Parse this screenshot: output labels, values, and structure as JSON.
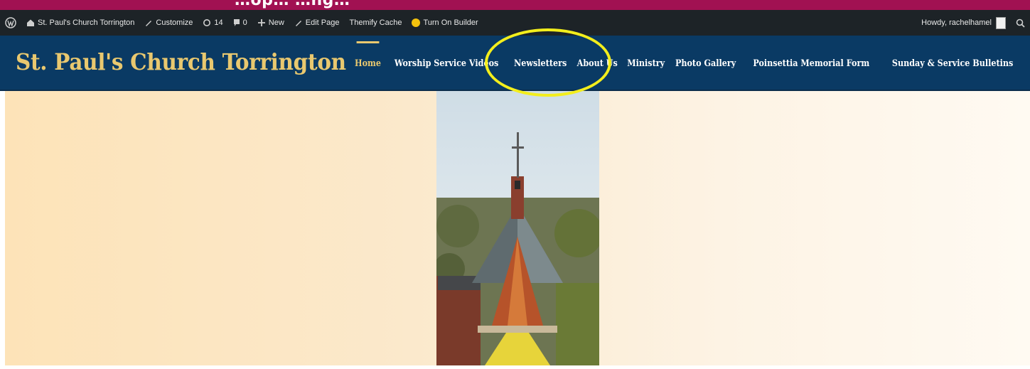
{
  "top_strip": {
    "partial_heading": "…op… …ng…"
  },
  "adminbar": {
    "site_name": "St. Paul's Church Torrington",
    "customize": "Customize",
    "updates_count": "14",
    "comments_count": "0",
    "new": "New",
    "edit_page": "Edit Page",
    "themify_cache": "Themify Cache",
    "turn_on_builder": "Turn On Builder",
    "howdy": "Howdy, rachelhamel"
  },
  "header": {
    "site_title": "St. Paul's Church Torrington",
    "nav": [
      {
        "label": "Home",
        "active": true
      },
      {
        "label": "Worship Service Videos"
      },
      {
        "label": "Newsletters"
      },
      {
        "label": "About Us"
      },
      {
        "label": "Ministry"
      },
      {
        "label": "Photo Gallery"
      },
      {
        "label": "Poinsettia Memorial Form"
      },
      {
        "label": "Sunday & Service Bulletins"
      }
    ]
  },
  "colors": {
    "brand_navy": "#0a3a64",
    "accent_gold": "#e9c86f",
    "admin_bar": "#1d2327",
    "top_strip": "#a11152",
    "annotation": "#f3ee1c"
  },
  "icons": [
    "wordpress-logo-icon",
    "home-icon",
    "pencil-icon",
    "refresh-icon",
    "comment-icon",
    "plus-icon",
    "edit-icon",
    "builder-icon",
    "search-icon"
  ]
}
